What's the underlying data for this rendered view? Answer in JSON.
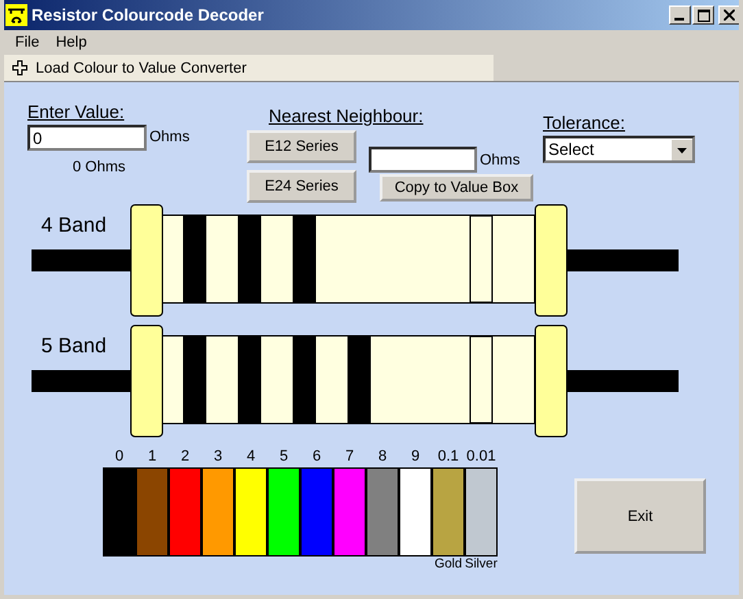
{
  "window": {
    "title": "Resistor Colourcode Decoder"
  },
  "menu": [
    {
      "label": "File"
    },
    {
      "label": "Help"
    }
  ],
  "toolbar": {
    "label": "Load Colour to Value Converter"
  },
  "enter_value": {
    "label": "Enter Value:",
    "value": "0",
    "unit": "Ohms",
    "reading": "0 Ohms"
  },
  "nearest_neighbour": {
    "label": "Nearest Neighbour:",
    "buttons": [
      "E12 Series",
      "E24 Series"
    ],
    "unit": "Ohms",
    "copy_button": "Copy to Value Box"
  },
  "tolerance": {
    "label": "Tolerance:",
    "value": "Select"
  },
  "resistors": [
    {
      "label": "4 Band",
      "bands": [
        {
          "color": "#000000"
        },
        {
          "color": "#000000"
        },
        {
          "color": "#000000"
        },
        {
          "color": "#ffffe0"
        }
      ]
    },
    {
      "label": "5 Band",
      "bands": [
        {
          "color": "#000000"
        },
        {
          "color": "#000000"
        },
        {
          "color": "#000000"
        },
        {
          "color": "#000000"
        },
        {
          "color": "#ffffe0"
        }
      ]
    }
  ],
  "palette": [
    {
      "value": "0",
      "color": "#000000"
    },
    {
      "value": "1",
      "color": "#8b4500"
    },
    {
      "value": "2",
      "color": "#ff0000"
    },
    {
      "value": "3",
      "color": "#ff9900"
    },
    {
      "value": "4",
      "color": "#ffff00"
    },
    {
      "value": "5",
      "color": "#00ff00"
    },
    {
      "value": "6",
      "color": "#0000ff"
    },
    {
      "value": "7",
      "color": "#ff00ff"
    },
    {
      "value": "8",
      "color": "#808080"
    },
    {
      "value": "9",
      "color": "#ffffff"
    },
    {
      "value": "0.1",
      "color": "#b8a442",
      "name": "Gold"
    },
    {
      "value": "0.01",
      "color": "#c0c8d0",
      "name": "Silver"
    }
  ],
  "exit_button": "Exit"
}
